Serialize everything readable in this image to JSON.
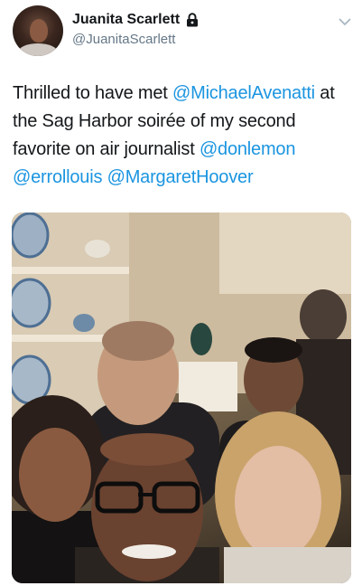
{
  "author": {
    "name": "Juanita Scarlett",
    "handle": "@JuanitaScarlett"
  },
  "tweet": {
    "segments": [
      {
        "text": "Thrilled to have met ",
        "type": "text"
      },
      {
        "text": "@MichaelAvenatti",
        "type": "mention"
      },
      {
        "text": " at the Sag Harbor soirée of my second favorite on air journalist ",
        "type": "text"
      },
      {
        "text": "@donlemon",
        "type": "mention"
      },
      {
        "text": " ",
        "type": "text"
      },
      {
        "text": "@errollouis",
        "type": "mention"
      },
      {
        "text": " ",
        "type": "text"
      },
      {
        "text": "@MargaretHoover",
        "type": "mention"
      }
    ]
  },
  "colors": {
    "mention": "#1b95e0",
    "text": "#14171a",
    "secondary": "#657786"
  },
  "icons": [
    "lock-icon",
    "chevron-down-icon"
  ]
}
